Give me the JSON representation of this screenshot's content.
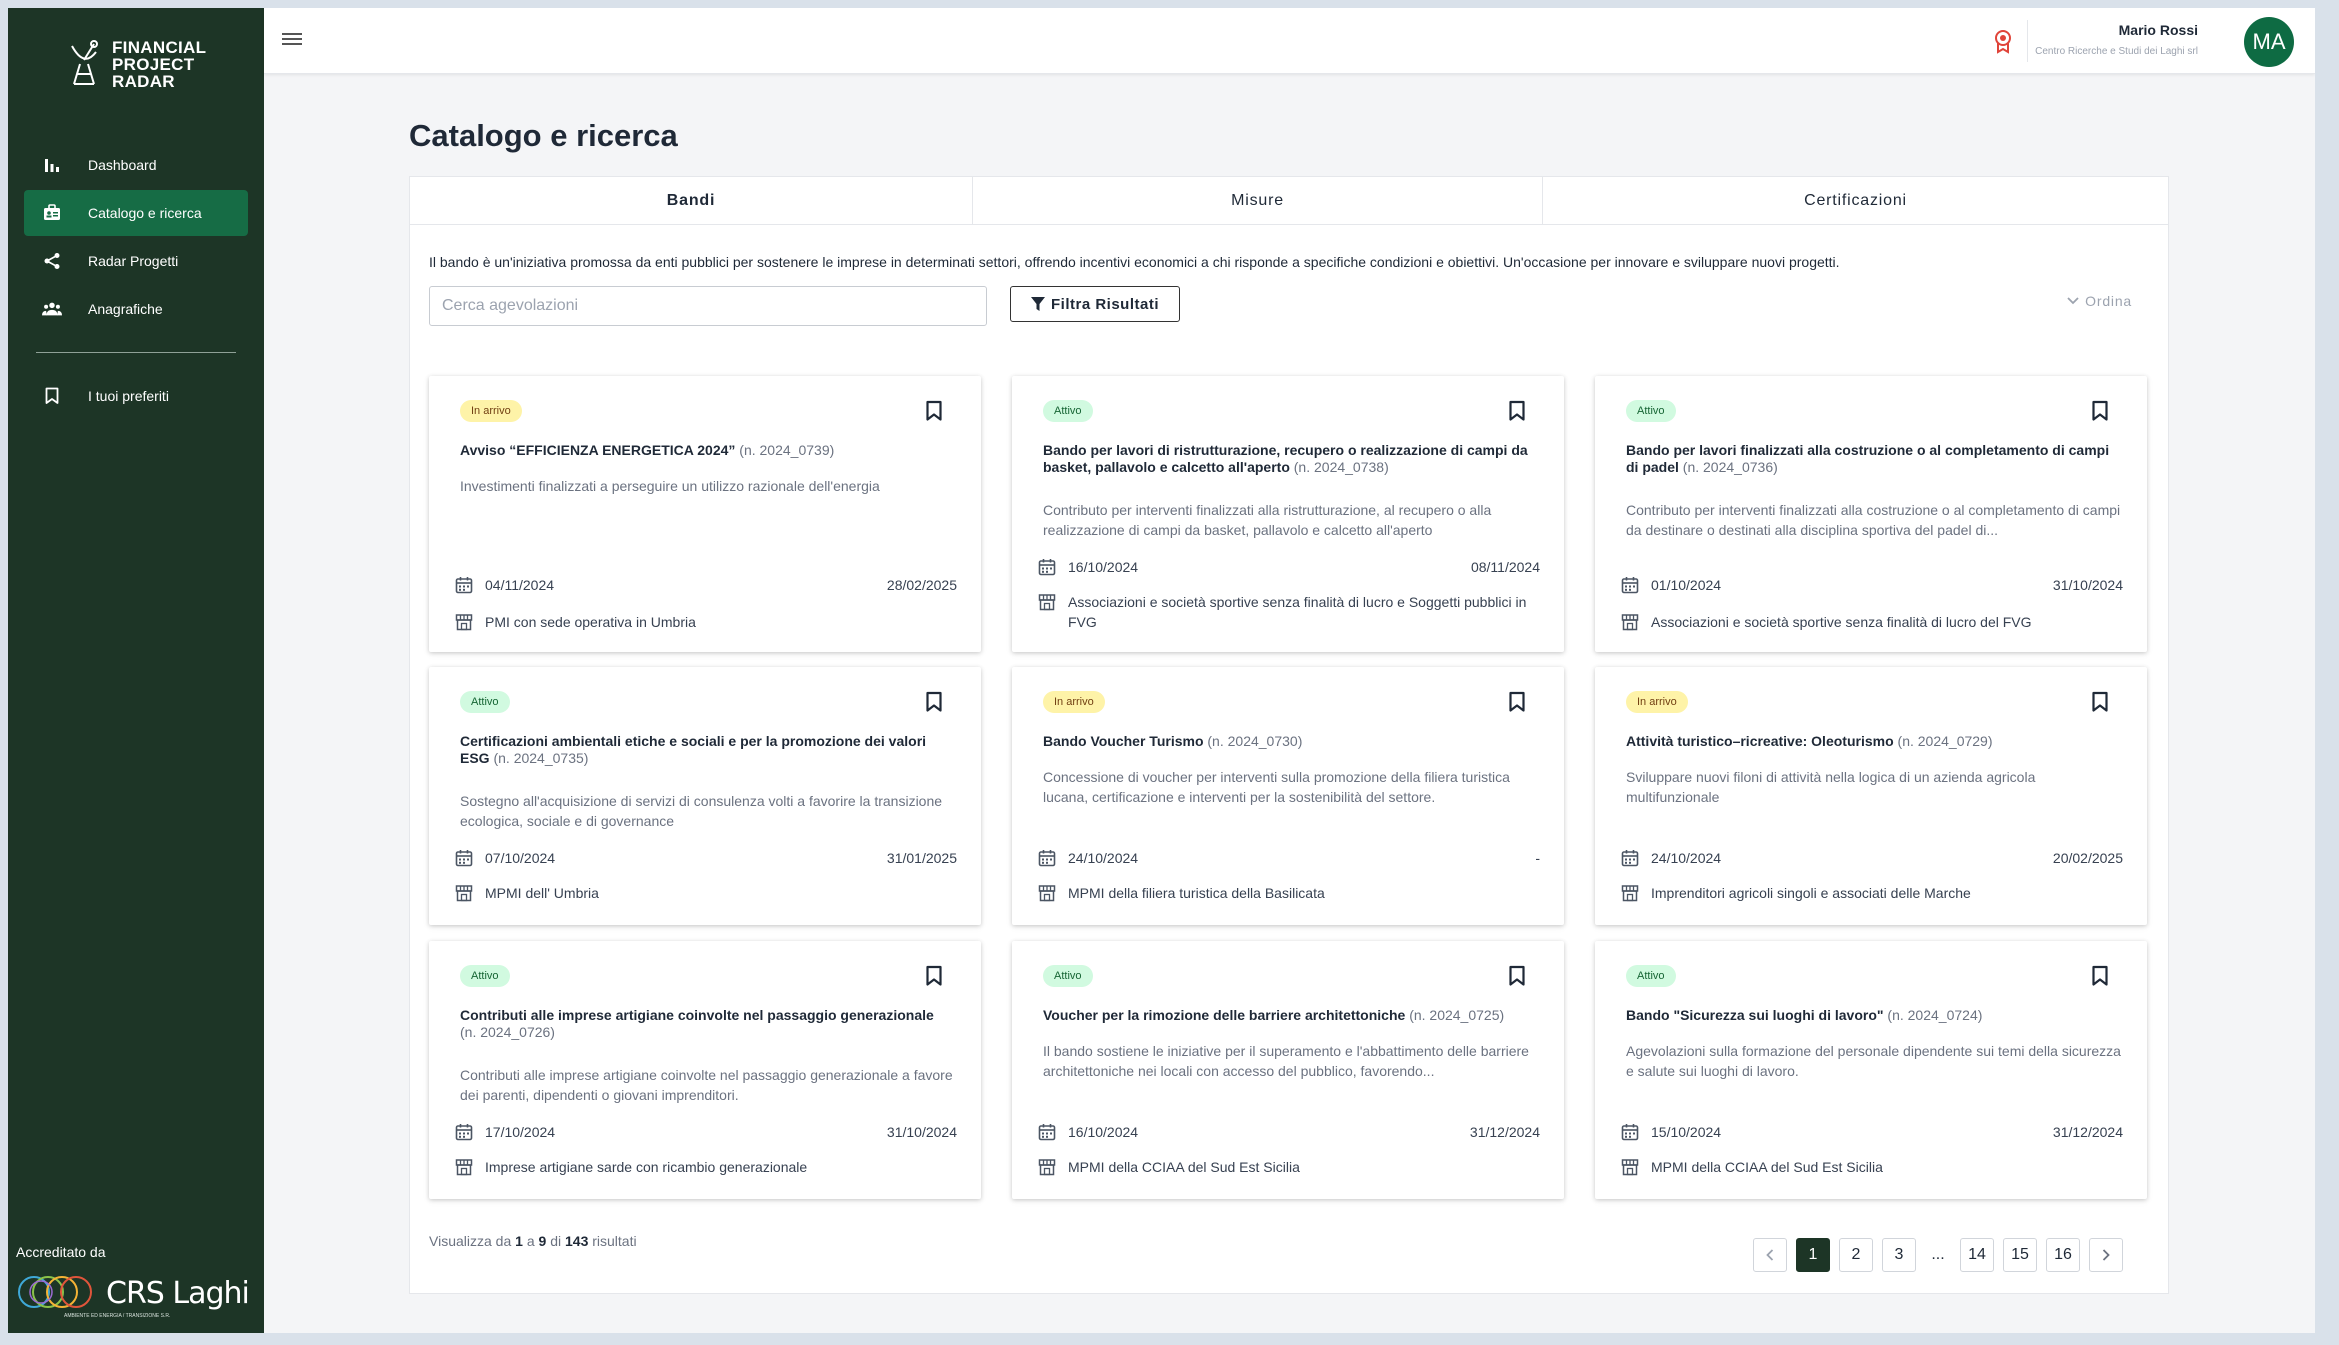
{
  "brand": {
    "line1": "FINANCIAL",
    "line2": "PROJECT",
    "line3": "RADAR"
  },
  "sidebar": {
    "items": [
      {
        "label": "Dashboard",
        "icon": "bar-chart-icon"
      },
      {
        "label": "Catalogo e ricerca",
        "icon": "catalog-icon"
      },
      {
        "label": "Radar Progetti",
        "icon": "share-icon"
      },
      {
        "label": "Anagrafiche",
        "icon": "people-icon"
      }
    ],
    "favorites": "I tuoi preferiti",
    "accredited": "Accreditato da",
    "partner": "CRS Laghi",
    "partner_sub": "AMBIENTE ED ENERGIA / TRANSIZIONE S.R."
  },
  "user": {
    "name": "Mario Rossi",
    "org": "Centro Ricerche e Studi dei Laghi srl",
    "initials": "MA"
  },
  "page": {
    "title": "Catalogo e ricerca"
  },
  "tabs": [
    "Bandi",
    "Misure",
    "Certificazioni"
  ],
  "intro": "Il bando è un'iniziativa promossa da enti pubblici per sostenere le imprese in determinati settori, offrendo incentivi economici a chi risponde a specifiche condizioni e obiettivi. Un'occasione per innovare e sviluppare nuovi progetti.",
  "search": {
    "placeholder": "Cerca agevolazioni",
    "filter_label": "Filtra Risultati",
    "sort_label": "Ordina"
  },
  "cards": [
    {
      "status": "In arrivo",
      "title": "Avviso “EFFICIENZA ENERGETICA 2024”",
      "num": "(n. 2024_0739)",
      "desc": "Investimenti finalizzati a perseguire un utilizzo razionale dell'energia",
      "start": "04/11/2024",
      "end": "28/02/2025",
      "who": "PMI con sede operativa in Umbria"
    },
    {
      "status": "Attivo",
      "title": "Bando per lavori di ristrutturazione, recupero o realizzazione di campi da basket, pallavolo e calcetto all'aperto",
      "num": "(n. 2024_0738)",
      "desc": "Contributo per interventi finalizzati alla ristrutturazione, al recupero o alla realizzazione di campi da basket, pallavolo e calcetto all'aperto",
      "start": "16/10/2024",
      "end": "08/11/2024",
      "who": "Associazioni e società sportive senza finalità di lucro e Soggetti pubblici in FVG"
    },
    {
      "status": "Attivo",
      "title": "Bando per lavori finalizzati alla costruzione o al completamento di campi di padel",
      "num": "(n. 2024_0736)",
      "desc": "Contributo per interventi finalizzati alla costruzione o al completamento di campi da destinare o destinati alla disciplina sportiva del padel di...",
      "start": "01/10/2024",
      "end": "31/10/2024",
      "who": "Associazioni e società sportive senza finalità di lucro del FVG"
    },
    {
      "status": "Attivo",
      "title": "Certificazioni ambientali etiche e sociali e per la promozione dei valori ESG",
      "num": "(n. 2024_0735)",
      "desc": "Sostegno all'acquisizione di servizi di consulenza volti a favorire la transizione ecologica, sociale e di governance",
      "start": "07/10/2024",
      "end": "31/01/2025",
      "who": "MPMI dell' Umbria"
    },
    {
      "status": "In arrivo",
      "title": "Bando Voucher Turismo",
      "num": "(n. 2024_0730)",
      "desc": "Concessione di voucher per interventi sulla promozione della filiera turistica lucana, certificazione e interventi per la sostenibilità del settore.",
      "start": "24/10/2024",
      "end": "-",
      "who": "MPMI della filiera turistica della Basilicata"
    },
    {
      "status": "In arrivo",
      "title": "Attività turistico–ricreative: Oleoturismo",
      "num": "(n. 2024_0729)",
      "desc": "Sviluppare nuovi filoni di attività nella logica di un azienda agricola multifunzionale",
      "start": "24/10/2024",
      "end": "20/02/2025",
      "who": "Imprenditori agricoli singoli e associati delle Marche"
    },
    {
      "status": "Attivo",
      "title": "Contributi alle imprese artigiane coinvolte nel passaggio generazionale",
      "num": "(n. 2024_0726)",
      "desc": "Contributi alle imprese artigiane coinvolte nel passaggio generazionale a favore dei parenti, dipendenti o giovani imprenditori.",
      "start": "17/10/2024",
      "end": "31/10/2024",
      "who": "Imprese artigiane sarde con ricambio generazionale"
    },
    {
      "status": "Attivo",
      "title": "Voucher per la rimozione delle barriere architettoniche",
      "num": "(n. 2024_0725)",
      "desc": "Il bando sostiene le iniziative per il superamento e l'abbattimento delle barriere architettoniche nei locali con accesso del pubblico, favorendo...",
      "start": "16/10/2024",
      "end": "31/12/2024",
      "who": "MPMI della CCIAA del Sud Est Sicilia"
    },
    {
      "status": "Attivo",
      "title": "Bando \"Sicurezza sui luoghi di lavoro\"",
      "num": "(n. 2024_0724)",
      "desc": "Agevolazioni sulla formazione del personale dipendente sui temi della sicurezza e salute sui luoghi di lavoro.",
      "start": "15/10/2024",
      "end": "31/12/2024",
      "who": "MPMI della CCIAA del Sud Est Sicilia"
    }
  ],
  "results": {
    "prefix": "Visualizza da",
    "from": "1",
    "a": "a",
    "to": "9",
    "di": "di",
    "total": "143",
    "suffix": "risultati"
  },
  "pagination": [
    "1",
    "2",
    "3",
    "...",
    "14",
    "15",
    "16"
  ],
  "colors": {
    "sidebar": "#1d3526",
    "active": "#166c45",
    "avatar": "#0e6b43",
    "attivo_bg": "#d1fae0",
    "arrivo_bg": "#fef3a8"
  }
}
